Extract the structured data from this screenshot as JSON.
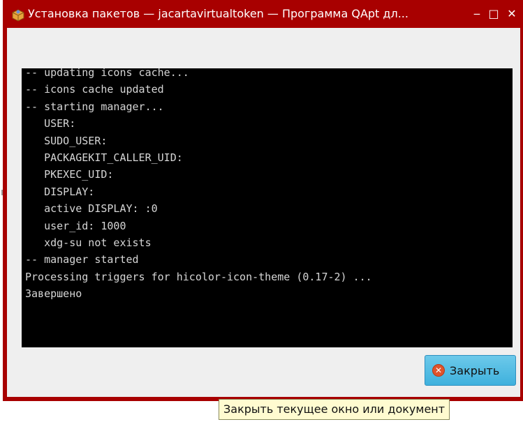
{
  "window": {
    "title": "Установка пакетов — jacartavirtualtoken — Программа QApt дл...",
    "app_icon": "package-box-icon",
    "controls": {
      "minimize": "‒",
      "maximize": "□",
      "close": "✕"
    }
  },
  "terminal": {
    "lines": [
      "-- updating icons cache...",
      "-- icons cache updated",
      "-- starting manager...",
      "   USER:",
      "   SUDO_USER:",
      "   PACKAGEKIT_CALLER_UID:",
      "   PKEXEC_UID:",
      "   DISPLAY:",
      "   active DISPLAY: :0",
      "   user_id: 1000",
      "   xdg-su not exists",
      "-- manager started",
      "Processing triggers for hicolor-icon-theme (0.17-2) ...",
      "Завершено"
    ]
  },
  "buttons": {
    "close_label": "Закрыть",
    "close_icon": "cancel-icon"
  },
  "tooltip": {
    "text": "Закрыть текущее окно или документ"
  },
  "colors": {
    "titlebar": "#a80000",
    "terminal_bg": "#000000",
    "terminal_text": "#d6d6d6",
    "button_accent": "#3fb1dd"
  }
}
